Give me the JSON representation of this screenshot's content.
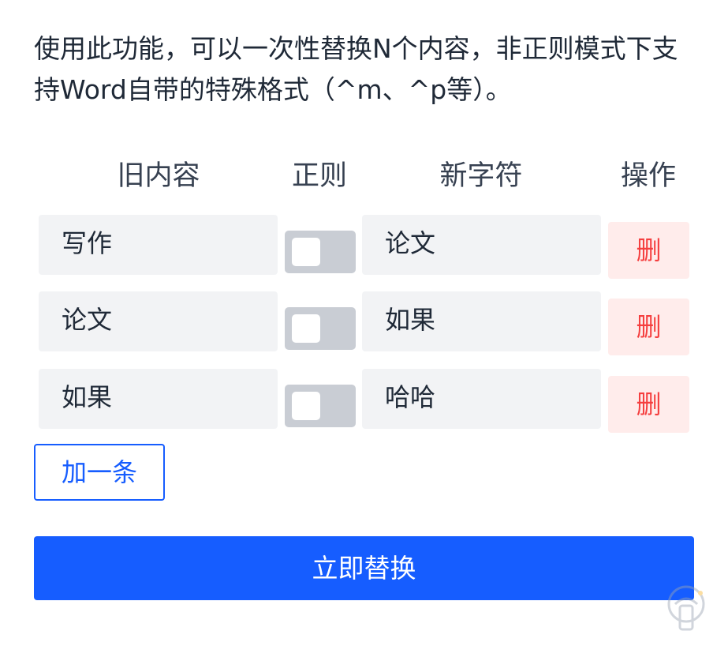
{
  "description": "使用此功能，可以一次性替换N个内容，非正则模式下支持Word自带的特殊格式（^m、^p等）。",
  "table": {
    "headers": {
      "old": "旧内容",
      "regex": "正则",
      "new": "新字符",
      "op": "操作"
    },
    "rows": [
      {
        "old": "写作",
        "regex": false,
        "new": "论文",
        "delete_label": "删"
      },
      {
        "old": "论文",
        "regex": false,
        "new": "如果",
        "delete_label": "删"
      },
      {
        "old": "如果",
        "regex": false,
        "new": "哈哈",
        "delete_label": "删"
      }
    ]
  },
  "add_button_label": "加一条",
  "submit_button_label": "立即替换",
  "colors": {
    "primary": "#165dff",
    "danger": "#f53f3f",
    "danger_bg": "#ffeceb",
    "field_bg": "#f2f3f5",
    "toggle_off": "#c9cdd4"
  },
  "icons": {
    "watermark": "logo-watermark-icon"
  }
}
